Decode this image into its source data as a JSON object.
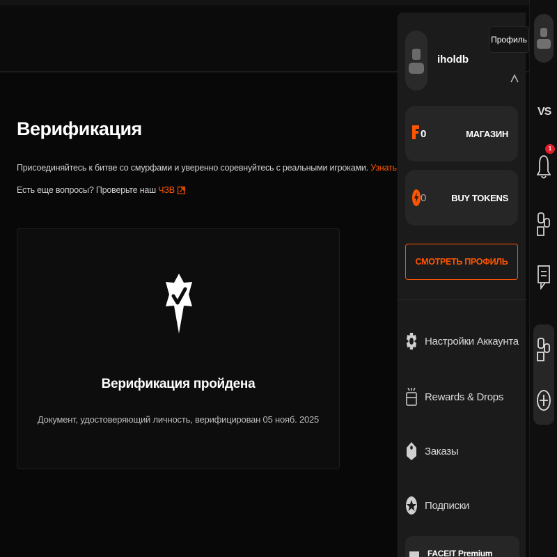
{
  "page": {
    "title": "Верификация",
    "line1_text": "Присоединяйтесь к битве со смурфами и уверенно соревнуйтесь с реальными игроками.",
    "line1_link": "Узнать больше",
    "line2_text": "Есть еще вопросы? Проверьте наш",
    "line2_link": "ЧЗВ"
  },
  "verification_card": {
    "title": "Верификация пройдена",
    "subtitle": "Документ, удостоверяющий личность, верифицирован 05 нояб. 2025"
  },
  "profile_menu": {
    "username": "iholdb",
    "shop": {
      "value": "0",
      "label": "МАГАЗИН"
    },
    "tokens": {
      "value": "0",
      "label": "BUY TOKENS"
    },
    "view_profile_label": "СМОТРЕТЬ ПРОФИЛЬ",
    "items": [
      {
        "label": "Настройки Аккаунта",
        "icon": "gear-icon"
      },
      {
        "label": "Rewards & Drops",
        "icon": "gift-box-icon"
      },
      {
        "label": "Заказы",
        "icon": "tag-icon"
      },
      {
        "label": "Подписки",
        "icon": "star-badge-icon"
      },
      {
        "label": "FACEIT Premium",
        "icon": "premium-icon"
      }
    ]
  },
  "right_rail": {
    "vs_label": "VS",
    "notification_count": "1",
    "tooltip": "Профиль"
  },
  "colors": {
    "accent": "#ff5500",
    "background": "#0a0a0a",
    "panel": "#1b1b1b",
    "notification": "#e11d2a"
  }
}
